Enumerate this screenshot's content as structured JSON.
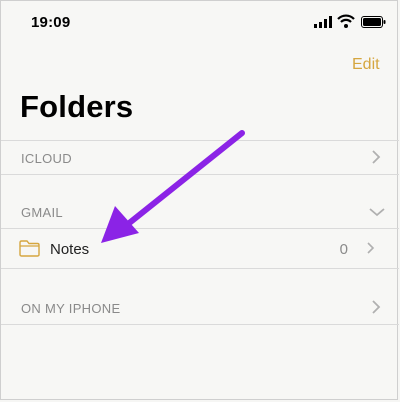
{
  "status_bar": {
    "time": "19:09"
  },
  "nav": {
    "edit_label": "Edit"
  },
  "page": {
    "title": "Folders"
  },
  "sections": [
    {
      "label": "ICLOUD"
    },
    {
      "label": "GMAIL"
    },
    {
      "label": "ON MY IPHONE"
    }
  ],
  "folders": [
    {
      "label": "Notes",
      "count": "0"
    }
  ],
  "colors": {
    "accent": "#d5a63f",
    "arrow": "#8b23e6"
  },
  "icons": [
    "signal-icon",
    "wifi-icon",
    "battery-icon",
    "chevron-right-icon",
    "chevron-down-icon",
    "folder-icon",
    "arrow-annotation"
  ]
}
